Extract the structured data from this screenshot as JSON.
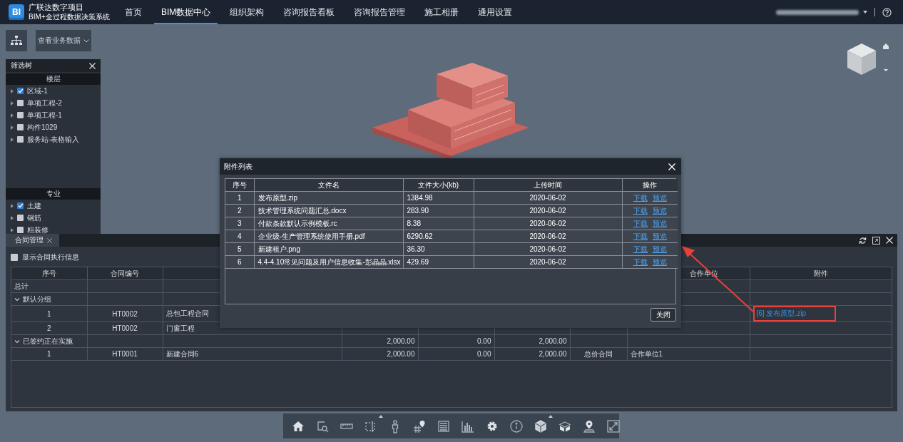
{
  "header": {
    "logo_text": "BI",
    "project": "广联达数字项目",
    "system": "BIM+全过程数据决策系统",
    "nav": [
      {
        "label": "首页",
        "selected": false
      },
      {
        "label": "BIM数据中心",
        "selected": true
      },
      {
        "label": "组织架构",
        "selected": false
      },
      {
        "label": "咨询报告看板",
        "selected": false
      },
      {
        "label": "咨询报告管理",
        "selected": false
      },
      {
        "label": "施工相册",
        "selected": false
      },
      {
        "label": "通用设置",
        "selected": false
      }
    ]
  },
  "viewer_toolbar": {
    "dropdown": "查看业务数据"
  },
  "filter_tree": {
    "title": "筛选树",
    "sections": [
      {
        "title": "楼层",
        "items": [
          {
            "label": "区域-1",
            "checked": true
          },
          {
            "label": "单项工程-2",
            "checked": false
          },
          {
            "label": "单项工程-1",
            "checked": false
          },
          {
            "label": "构件1029",
            "checked": false
          },
          {
            "label": "服务站-表格输入",
            "checked": false
          }
        ]
      },
      {
        "title": "专业",
        "items": [
          {
            "label": "土建",
            "checked": true
          },
          {
            "label": "钢筋",
            "checked": false
          },
          {
            "label": "粗装修",
            "checked": false
          }
        ]
      }
    ]
  },
  "contract_panel": {
    "tab": "合同管理",
    "show_exec_info": {
      "label": "显示合同执行信息",
      "checked": false
    },
    "columns": [
      {
        "label": "序号"
      },
      {
        "label": "合同编号"
      },
      {},
      {},
      {},
      {},
      {},
      {
        "label": "合作单位"
      },
      {
        "label": "附件"
      }
    ],
    "rows": [
      {
        "kind": "total",
        "label": "总计"
      },
      {
        "kind": "group",
        "label": "默认分组",
        "expanded": true
      },
      {
        "kind": "item",
        "no": "1",
        "code": "HT0002",
        "name": "总包工程合同",
        "attachment": {
          "text": "[6] 发布原型.zip",
          "highlighted": true
        }
      },
      {
        "kind": "item",
        "no": "2",
        "code": "HT0002",
        "name": "门窗工程"
      },
      {
        "kind": "group",
        "label": "已签约正在实施",
        "expanded": true,
        "amount": "2,000.00",
        "supplement": "0.00",
        "total": "2,000.00"
      },
      {
        "kind": "item",
        "no": "1",
        "code": "HT0001",
        "name": "新建合同6",
        "amount": "2,000.00",
        "supplement": "0.00",
        "total": "2,000.00",
        "type": "总价合同",
        "partner": "合作单位1"
      }
    ]
  },
  "attachment_dialog": {
    "title": "附件列表",
    "columns": [
      "序号",
      "文件名",
      "文件大小(kb)",
      "上传时间",
      "操作"
    ],
    "rows": [
      {
        "no": "1",
        "name": "发布原型.zip",
        "size": "1384.98",
        "time": "2020-06-02",
        "actions": [
          "下载",
          "预览"
        ]
      },
      {
        "no": "2",
        "name": "技术管理系统问题汇总.docx",
        "size": "283.90",
        "time": "2020-06-02",
        "actions": [
          "下载",
          "预览"
        ]
      },
      {
        "no": "3",
        "name": "付款条款默认示例模板.rc",
        "size": "8.38",
        "time": "2020-06-02",
        "actions": [
          "下载",
          "预览"
        ]
      },
      {
        "no": "4",
        "name": "企业级-生产管理系统使用手册.pdf",
        "size": "6290.62",
        "time": "2020-06-02",
        "actions": [
          "下载",
          "预览"
        ]
      },
      {
        "no": "5",
        "name": "新建租户.png",
        "size": "36.30",
        "time": "2020-06-02",
        "actions": [
          "下载",
          "预览"
        ]
      },
      {
        "no": "6",
        "name": "4.4-4.10常见问题及用户信息收集-彭晶晶.xlsx",
        "size": "429.69",
        "time": "2020-06-02",
        "actions": [
          "下载",
          "预览"
        ]
      }
    ],
    "close": "关闭"
  },
  "bottom_toolbar": [
    {
      "kind": "home",
      "has_menu": false
    },
    {
      "kind": "zoom-area",
      "has_menu": false
    },
    {
      "kind": "ruler",
      "has_menu": false
    },
    {
      "kind": "section",
      "has_menu": true
    },
    {
      "kind": "person",
      "has_menu": false
    },
    {
      "kind": "pin-grid",
      "has_menu": false
    },
    {
      "kind": "list",
      "has_menu": false
    },
    {
      "kind": "chart",
      "has_menu": false
    },
    {
      "kind": "gear",
      "has_menu": false
    },
    {
      "kind": "info",
      "has_menu": false
    },
    {
      "kind": "cube",
      "has_menu": true
    },
    {
      "kind": "cube-open",
      "has_menu": false
    },
    {
      "kind": "map-pin",
      "has_menu": false
    },
    {
      "kind": "expand",
      "has_menu": false
    }
  ]
}
